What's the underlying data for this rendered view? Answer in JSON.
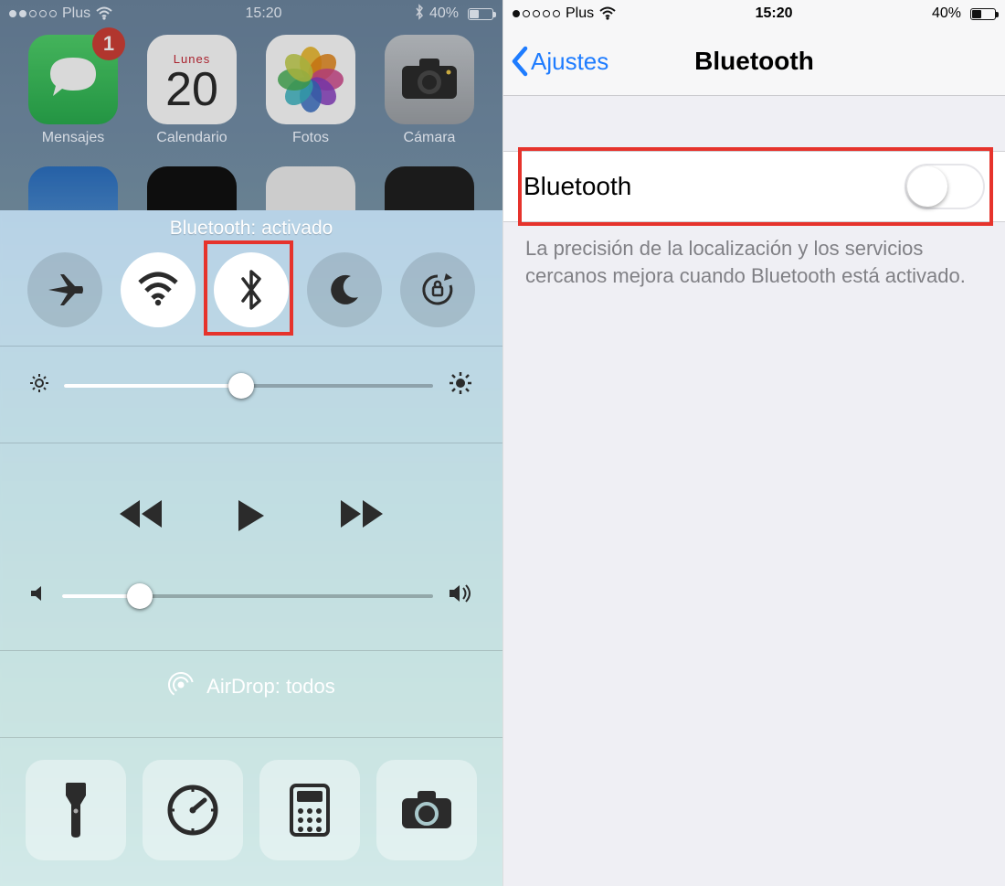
{
  "left": {
    "status": {
      "carrier": "Plus",
      "time": "15:20",
      "battery": "40%",
      "signal_filled": 2
    },
    "apps": {
      "messages": {
        "label": "Mensajes",
        "badge": "1"
      },
      "calendar": {
        "label": "Calendario",
        "dow": "Lunes",
        "day": "20"
      },
      "photos": {
        "label": "Fotos"
      },
      "camera": {
        "label": "Cámara"
      }
    },
    "cc": {
      "title": "Bluetooth: activado",
      "airdrop": "AirDrop: todos",
      "brightness_pct": 48,
      "volume_pct": 21
    }
  },
  "right": {
    "status": {
      "carrier": "Plus",
      "time": "15:20",
      "battery": "40%",
      "signal_filled": 1
    },
    "nav": {
      "back": "Ajustes",
      "title": "Bluetooth"
    },
    "cell": {
      "label": "Bluetooth"
    },
    "footer": "La precisión de la localización y los servicios cercanos mejora cuando Bluetooth está activado."
  }
}
